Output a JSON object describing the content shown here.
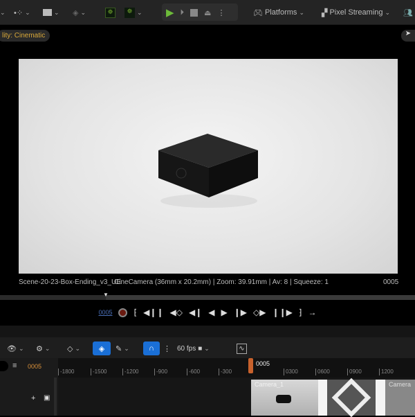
{
  "toolbar": {
    "play_controls": [
      "play",
      "skip",
      "stop",
      "eject"
    ],
    "platforms_label": "Platforms",
    "pixel_streaming_label": "Pixel Streaming"
  },
  "viewport": {
    "scalability_badge": "lity: Cinematic",
    "info_left": "Scene-20-23-Box-Ending_v3_UE",
    "info_camera": "CineCamera (36mm x 20.2mm) | Zoom: 39.91mm | Av: 8 | Squeeze: 1",
    "frame": "0005"
  },
  "transport": {
    "current_frame": "0005"
  },
  "sequencer": {
    "fps_label": "60 fps",
    "current_frame": "0005",
    "playhead_label": "0005",
    "ticks": [
      "-1800",
      "-1500",
      "-1200",
      "-900",
      "-600",
      "-300",
      "0300",
      "0600",
      "0900",
      "1200"
    ],
    "shot_label": "Camera_1",
    "shot_label_2": "Camera"
  },
  "colors": {
    "accent_blue": "#1a6fd6",
    "play_green": "#6dbb3a",
    "playhead_orange": "#c7612c",
    "badge_text": "#d9a93a"
  }
}
